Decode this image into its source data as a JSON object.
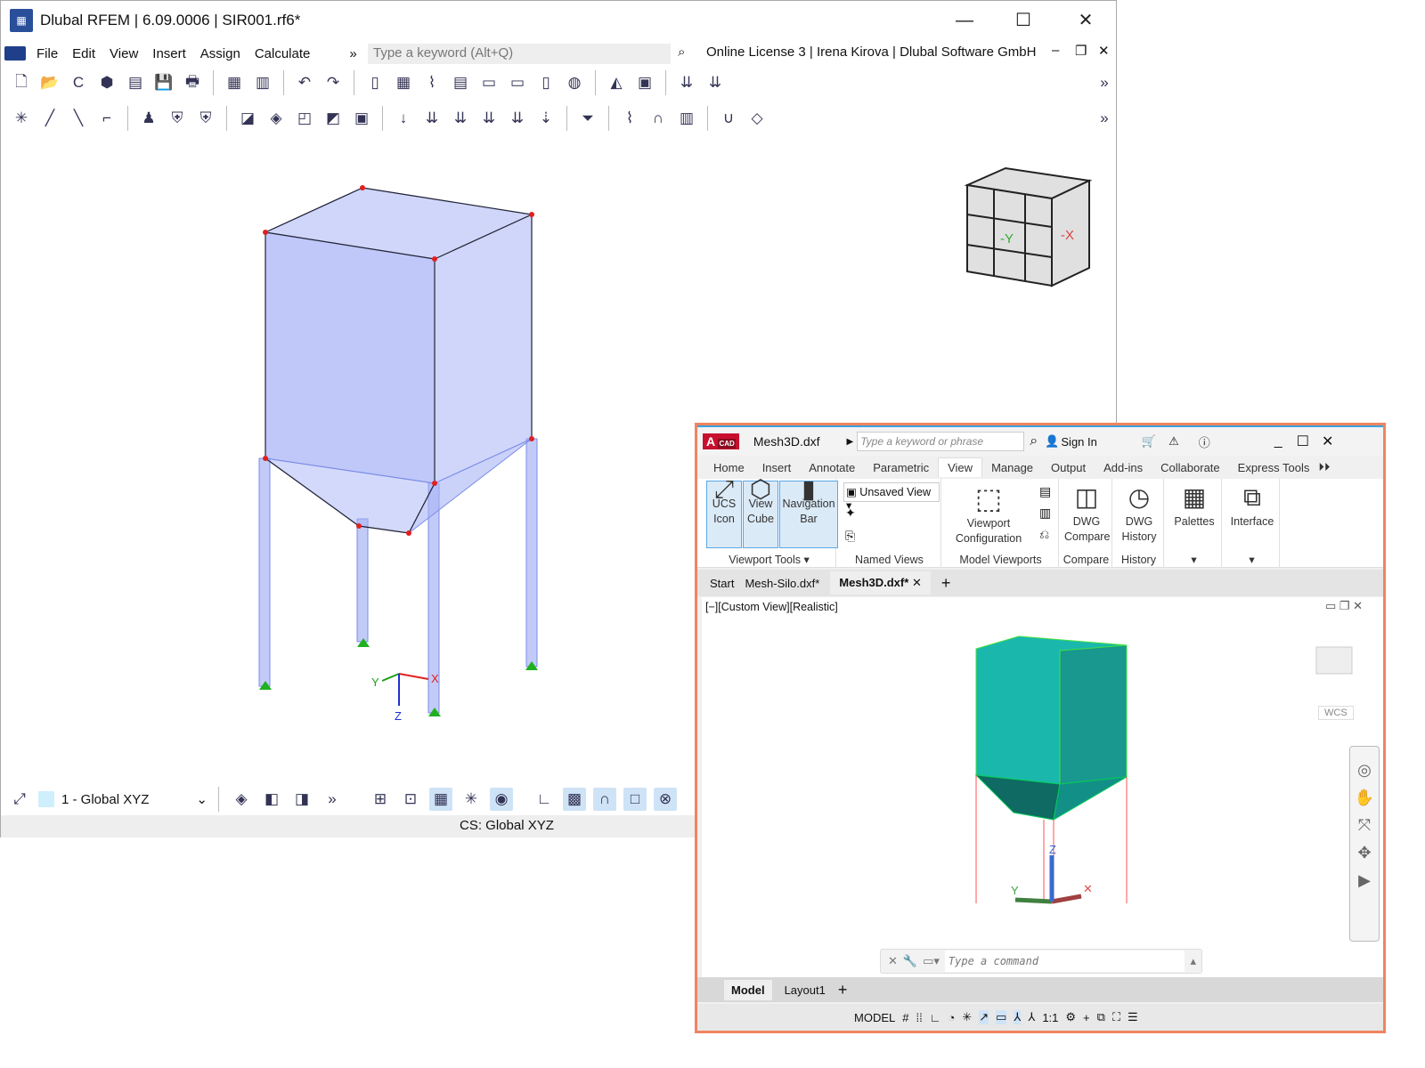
{
  "rfem": {
    "title": "Dlubal RFEM | 6.09.0006 | SIR001.rf6*",
    "menu": [
      "File",
      "Edit",
      "View",
      "Insert",
      "Assign",
      "Calculate"
    ],
    "menu_more": "»",
    "search_placeholder": "Type a keyword (Alt+Q)",
    "license": "Online License 3 | Irena Kirova | Dlubal Software GmbH",
    "view_select": "1 - Global XYZ",
    "status": "CS: Global XYZ",
    "axes": {
      "x": "X",
      "y": "Y",
      "z": "Z"
    },
    "viewcube": {
      "y": "-Y",
      "x": "-X"
    },
    "model_color": "#a8b4f5"
  },
  "cad": {
    "logo": "CAD",
    "file": "Mesh3D.dxf",
    "search_placeholder": "Type a keyword or phrase",
    "sign_in": "Sign In",
    "tabs": [
      "Home",
      "Insert",
      "Annotate",
      "Parametric",
      "View",
      "Manage",
      "Output",
      "Add-ins",
      "Collaborate",
      "Express Tools"
    ],
    "active_tab": "View",
    "ribbon": {
      "ucs_icon": [
        "UCS",
        "Icon"
      ],
      "view_cube": [
        "View",
        "Cube"
      ],
      "navigation_bar": [
        "Navigation",
        "Bar"
      ],
      "viewport_tools": "Viewport Tools",
      "named_view_select": "Unsaved View",
      "named_views": "Named Views",
      "viewport_configuration": [
        "Viewport",
        "Configuration"
      ],
      "model_viewports": "Model Viewports",
      "dwg_compare": [
        "DWG",
        "Compare"
      ],
      "compare": "Compare",
      "dwg_history": [
        "DWG",
        "History"
      ],
      "history": "History",
      "palettes": "Palettes",
      "interface": "Interface"
    },
    "doc_tabs": [
      "Start",
      "Mesh-Silo.dxf*",
      "Mesh3D.dxf*"
    ],
    "active_doc": "Mesh3D.dxf*",
    "view_label": "[−][Custom View][Realistic]",
    "wcs": "WCS",
    "command_placeholder": "Type a command",
    "layout_tabs": [
      "Model",
      "Layout1"
    ],
    "status_model": "MODEL",
    "scale": "1:1",
    "border_color": "#f0845f",
    "model_color": "#1aa89e"
  }
}
